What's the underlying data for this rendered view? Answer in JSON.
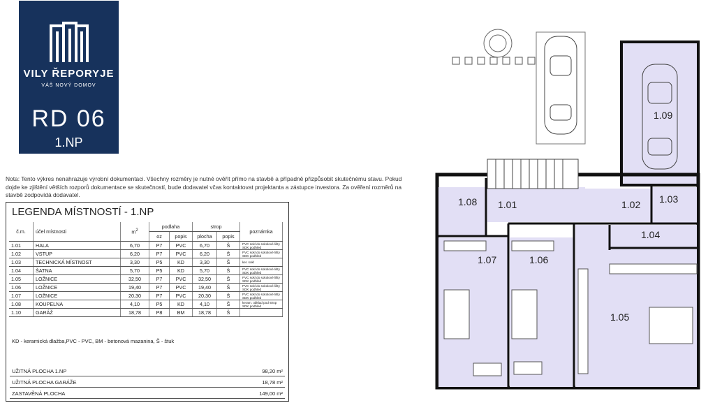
{
  "brand": {
    "name": "VILY ŘEPORYJE",
    "tagline": "VÁŠ NOVÝ DOMOV",
    "code": "RD 06",
    "floor": "1.NP",
    "color": "#17325c"
  },
  "note": {
    "label": "Nota:",
    "text": "Tento výkres nenahrazuje výrobní dokumentaci. Všechny rozměry je nutné ověřit přímo na stavbě a případně přizpůsobit skutečnému stavu. Pokud dojde ke zjištění větších rozporů dokumentace se skutečností, bude dodavatel včas kontaktovat projektanta a zástupce investora. Za ověření rozměrů na stavbě zodpovídá dodavatel."
  },
  "legend": {
    "title": "LEGENDA MÍSTNOSTÍ - 1.NP",
    "headers": {
      "number": "č.m.",
      "purpose": "účel místnosti",
      "area": "m",
      "area_sup": "2",
      "floor_group": "podlaha",
      "ceiling_group": "strop",
      "remark": "poznámka",
      "oz": "oz",
      "popis": "popis",
      "plocha": "plocha",
      "popis2": "popis"
    },
    "rooms": [
      {
        "num": "1.01",
        "name": "HALA",
        "area": "6,70",
        "oz": "P7",
        "popis": "PVC",
        "plocha": "6,70",
        "strop": "Š",
        "note": "PVC sokl do sokolové lišty SDK podhled"
      },
      {
        "num": "1.02",
        "name": "VSTUP",
        "area": "6,20",
        "oz": "P7",
        "popis": "PVC",
        "plocha": "6,20",
        "strop": "Š",
        "note": "PVC sokl do sokolové lišty SDK podhled"
      },
      {
        "num": "1.03",
        "name": "TECHNICKÁ MÍSTNOST",
        "area": "3,30",
        "oz": "P5",
        "popis": "KD",
        "plocha": "3,30",
        "strop": "Š",
        "note": "ker. sokl"
      },
      {
        "num": "1.04",
        "name": "ŠATNA",
        "area": "5,70",
        "oz": "P5",
        "popis": "KD",
        "plocha": "5,70",
        "strop": "Š",
        "note": "PVC sokl do sokolové lišty SDK podhled"
      },
      {
        "num": "1.05",
        "name": "LOŽNICE",
        "area": "32,50",
        "oz": "P7",
        "popis": "PVC",
        "plocha": "32,50",
        "strop": "Š",
        "note": "PVC sokl do sokolové lišty SDK podhled"
      },
      {
        "num": "1.06",
        "name": "LOŽNICE",
        "area": "19,40",
        "oz": "P7",
        "popis": "PVC",
        "plocha": "19,40",
        "strop": "Š",
        "note": "PVC sokl do sokolové lišty SDK podhled"
      },
      {
        "num": "1.07",
        "name": "LOŽNICE",
        "area": "20,30",
        "oz": "P7",
        "popis": "PVC",
        "plocha": "20,30",
        "strop": "Š",
        "note": "PVC sokl do sokolové lišty SDK podhled"
      },
      {
        "num": "1.08",
        "name": "KOUPELNA",
        "area": "4,10",
        "oz": "P5",
        "popis": "KD",
        "plocha": "4,10",
        "strop": "Š",
        "note": "keram. obklad pod strop SDK podhled"
      },
      {
        "num": "1.10",
        "name": "GARÁŽ",
        "area": "18,78",
        "oz": "P8",
        "popis": "BM",
        "plocha": "18,78",
        "strop": "Š",
        "note": ""
      }
    ],
    "abbreviations": "KD - keramická dlažba,PVC - PVC, BM - betonová mazanina, Š - štuk",
    "totals": [
      {
        "label": "UŽITNÁ PLOCHA 1.NP",
        "value": "98,20 m²"
      },
      {
        "label": "UŽITNÁ PLOCHA GARÁŽE",
        "value": "18,78 m²"
      },
      {
        "label": "ZASTAVĚNÁ PLOCHA",
        "value": "149,00 m²"
      }
    ]
  },
  "plan": {
    "room_color": "#e2dff5",
    "labels": {
      "r101": "1.01",
      "r102": "1.02",
      "r103": "1.03",
      "r104": "1.04",
      "r105": "1.05",
      "r106": "1.06",
      "r107": "1.07",
      "r108": "1.08",
      "r109": "1.09"
    }
  }
}
